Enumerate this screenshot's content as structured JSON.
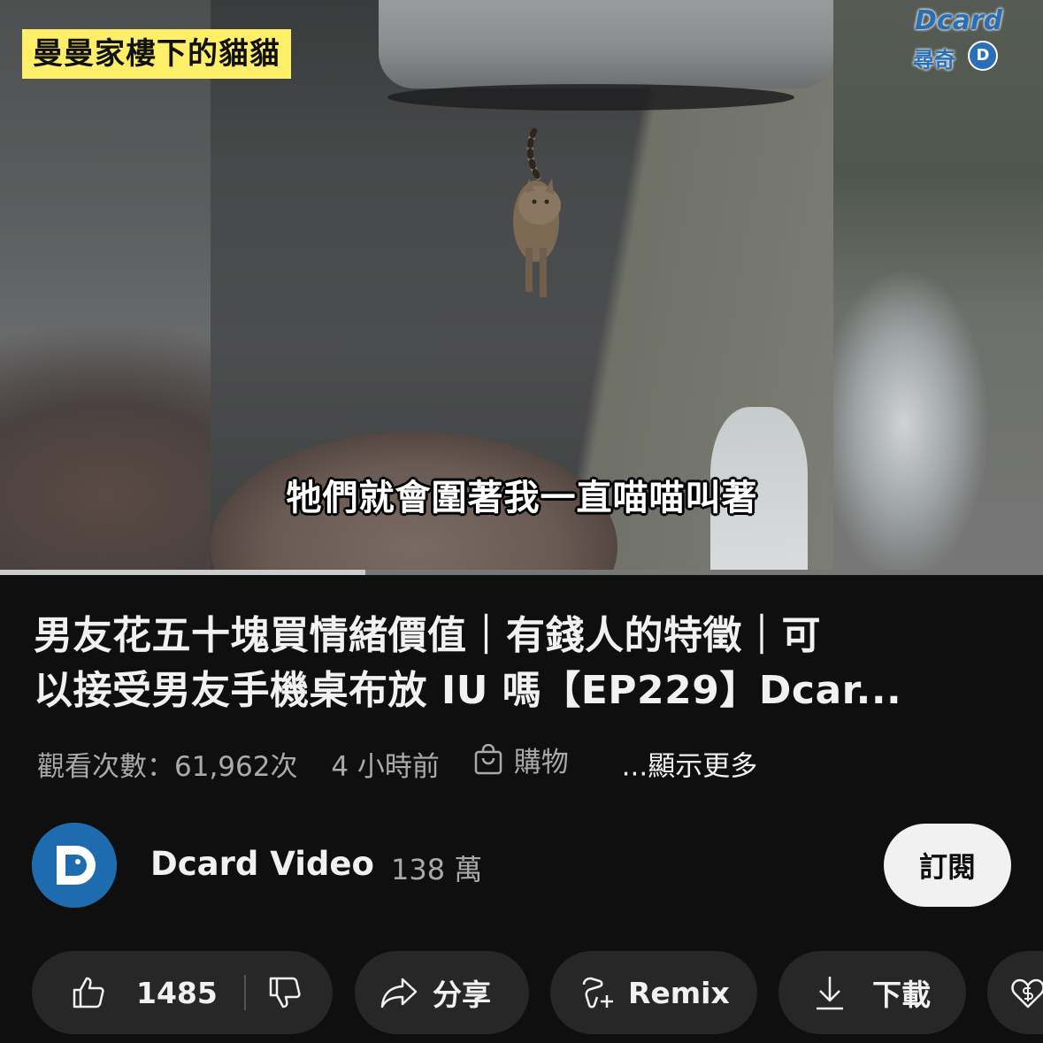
{
  "video": {
    "overlay_tag": "曼曼家樓下的貓貓",
    "subtitle": "牠們就會圍著我一直喵喵叫著",
    "watermark": {
      "brand": "Dcard",
      "sub": "尋奇"
    },
    "progress": 0.35
  },
  "info": {
    "title_line1": "男友花五十塊買情緒價值｜有錢人的特徵｜可",
    "title_line2": "以接受男友手機桌布放 IU 嗎【EP229】Dcar...",
    "views": "觀看次數：61,962次",
    "age": "4 小時前",
    "shopping": "購物",
    "show_more": "...顯示更多"
  },
  "channel": {
    "name": "Dcard Video",
    "subscribers": "138 萬",
    "subscribe_label": "訂閱"
  },
  "actions": {
    "like_count": "1485",
    "share_label": "分享",
    "remix_label": "Remix",
    "download_label": "下載"
  },
  "colors": {
    "background": "#0f0f0f",
    "pill": "#272727",
    "tag_yellow": "#ffef68",
    "brand_blue": "#1e6bb0"
  },
  "icons": [
    "thumbs-up-icon",
    "thumbs-down-icon",
    "share-icon",
    "remix-icon",
    "download-icon",
    "thanks-icon",
    "shopping-bag-icon"
  ]
}
